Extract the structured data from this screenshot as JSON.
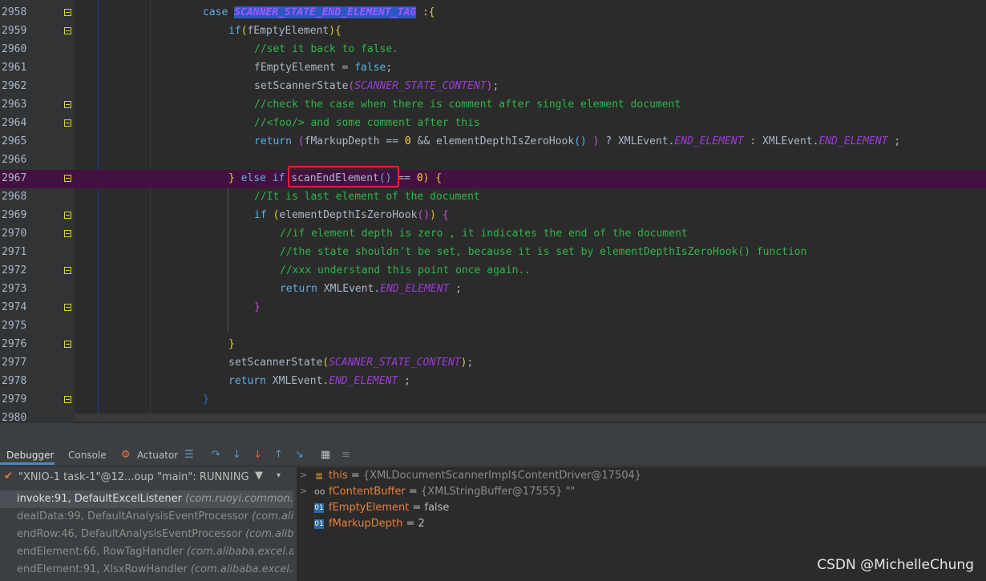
{
  "editor": {
    "lines": [
      {
        "num": "2958"
      },
      {
        "num": "2959"
      },
      {
        "num": "2960"
      },
      {
        "num": "2961"
      },
      {
        "num": "2962"
      },
      {
        "num": "2963"
      },
      {
        "num": "2964"
      },
      {
        "num": "2965"
      },
      {
        "num": "2966"
      },
      {
        "num": "2967"
      },
      {
        "num": "2968"
      },
      {
        "num": "2969"
      },
      {
        "num": "2970"
      },
      {
        "num": "2971"
      },
      {
        "num": "2972"
      },
      {
        "num": "2973"
      },
      {
        "num": "2974"
      },
      {
        "num": "2975"
      },
      {
        "num": "2976"
      },
      {
        "num": "2977"
      },
      {
        "num": "2978"
      },
      {
        "num": "2979"
      },
      {
        "num": "2980"
      }
    ],
    "t": {
      "case_kw": "case",
      "case_const": "SCANNER_STATE_END_ELEMENT_TAG",
      "case_colon": " :",
      "if_kw": "if",
      "fEmptyElement": "fEmptyElement",
      "c1": "//set it back to false.",
      "assign": "fEmptyElement = ",
      "false_kw": "false",
      "semi": ";",
      "setState": "setScannerState",
      "state_content": "SCANNER_STATE_CONTENT",
      "c2": "//check the case when there is comment after single element document",
      "c3": "//<foo/> and some comment after this",
      "return_kw": "return",
      "fMarkupDepth": "fMarkupDepth == ",
      "zero": "0",
      "and_hook": " && elementDepthIsZeroHook",
      "ternary": " ? XMLEvent.",
      "end_element": "END_ELEMENT",
      "colon_x": " : XMLEvent.",
      "else_kw": "else",
      "scanEnd": "scanEndElement",
      "eqeq": " == ",
      "c4": "//It is last element of the document",
      "hook": "elementDepthIsZeroHook",
      "c5": "//if element depth is zero , it indicates the end of the document",
      "c6": "//the state shouldn't be set, because it is set by elementDepthIsZeroHook() function",
      "c7": "//xxx understand this point once again..",
      "xmlevent": "XMLEvent."
    }
  },
  "tabs": {
    "debugger": "Debugger",
    "console": "Console",
    "actuator": "Actuator"
  },
  "thread": {
    "label": "\"XNIO-1 task-1\"@12...oup \"main\": RUNNING"
  },
  "frames": [
    {
      "method": "invoke:91, DefaultExcelListener",
      "pkg": "(com.ruoyi.common.exc"
    },
    {
      "method": "dealData:99, DefaultAnalysisEventProcessor",
      "pkg": "(com.alibab"
    },
    {
      "method": "endRow:46, DefaultAnalysisEventProcessor",
      "pkg": "(com.alibaba"
    },
    {
      "method": "endElement:66, RowTagHandler",
      "pkg": "(com.alibaba.excel.analy"
    },
    {
      "method": "endElement:91, XlsxRowHandler",
      "pkg": "(com.alibaba.excel.analy"
    }
  ],
  "variables": [
    {
      "name": "this",
      "eq": " = ",
      "value": "{XMLDocumentScannerImpl$ContentDriver@17504}",
      "icon": "field-icon"
    },
    {
      "name": "fContentBuffer",
      "eq": " = ",
      "value": "{XMLStringBuffer@17555} \"\"",
      "icon": "watch-icon"
    },
    {
      "name": "fEmptyElement",
      "eq": " = ",
      "value": "false",
      "icon": "primitive-icon"
    },
    {
      "name": "fMarkupDepth",
      "eq": " = ",
      "value": "2",
      "icon": "primitive-icon"
    }
  ],
  "watermark": "CSDN @MichelleChung",
  "colors": {
    "highlight_line": "#43113f",
    "selection": "#2c58c4",
    "box": "#e0232c",
    "comment": "#2fb54a",
    "keyword": "#5dafe6",
    "var_name": "#e8823a"
  }
}
